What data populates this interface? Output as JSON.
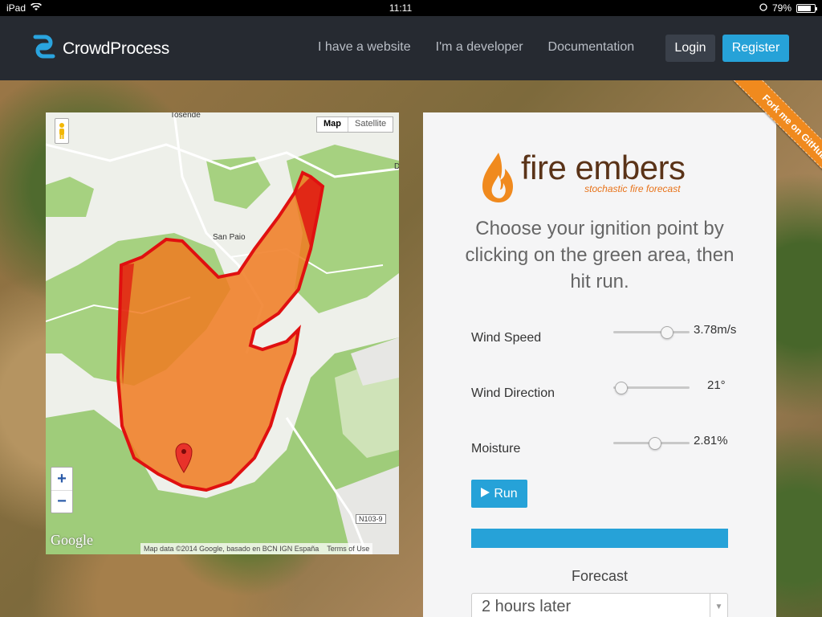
{
  "status_bar": {
    "device": "iPad",
    "time": "11:11",
    "battery": "79%",
    "battery_level": 0.79
  },
  "nav": {
    "brand": "CrowdProcess",
    "links": [
      "I have a website",
      "I'm a developer",
      "Documentation"
    ],
    "login": "Login",
    "register": "Register"
  },
  "ribbon": {
    "label": "Fork me on GitHub"
  },
  "map": {
    "type_map": "Map",
    "type_satellite": "Satellite",
    "zoom_in": "+",
    "zoom_out": "−",
    "logo": "Google",
    "attribution": "Map data ©2014 Google, basado en BCN IGN España",
    "terms": "Terms of Use",
    "places": {
      "tosende": "Tosende",
      "san_paio": "San Paio",
      "road": "N103-9",
      "edge_d": "D"
    }
  },
  "app": {
    "title": "fire embers",
    "subtitle": "stochastic fire forecast",
    "instructions": "Choose your ignition point by clicking on the green area, then hit run.",
    "controls": [
      {
        "label": "Wind Speed",
        "value": "3.78m/s",
        "level": 0.7
      },
      {
        "label": "Wind Direction",
        "value": "21°",
        "level": 0.1
      },
      {
        "label": "Moisture",
        "value": "2.81%",
        "level": 0.55
      }
    ],
    "run_label": "Run",
    "progress": 1.0,
    "forecast_label": "Forecast",
    "forecast_value": "2 hours later"
  },
  "colors": {
    "accent": "#26a2d8",
    "nav_bg": "#262a31",
    "fire": "#f07a20",
    "fire_border": "#e01010",
    "ribbon": "#f08a1e"
  }
}
